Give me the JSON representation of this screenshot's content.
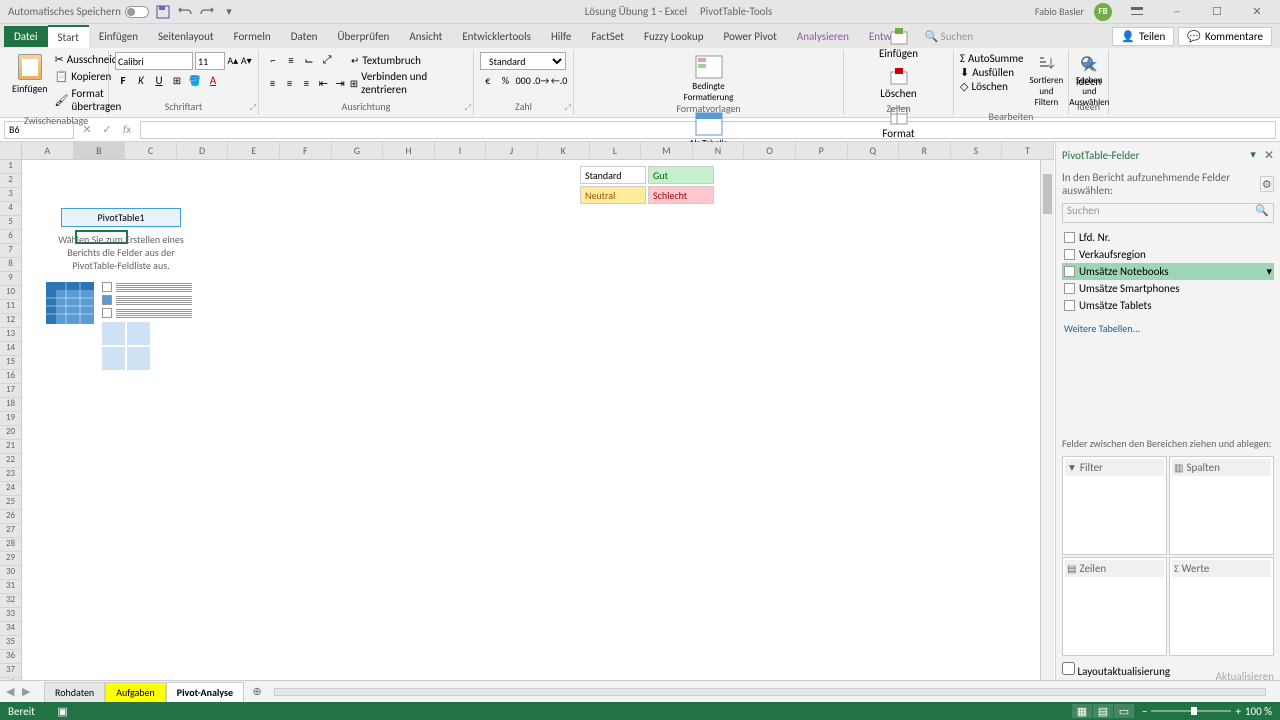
{
  "titlebar": {
    "autosave": "Automatisches Speichern",
    "doc_title": "Lösung Übung 1 - Excel",
    "context_tool": "PivotTable-Tools",
    "user_name": "Fabio Basler",
    "user_initials": "FB"
  },
  "tabs": {
    "file": "Datei",
    "items": [
      "Start",
      "Einfügen",
      "Seitenlayout",
      "Formeln",
      "Daten",
      "Überprüfen",
      "Ansicht",
      "Entwicklertools",
      "Hilfe",
      "FactSet",
      "Fuzzy Lookup",
      "Power Pivot",
      "Analysieren",
      "Entwurf"
    ],
    "search_hint": "Suchen",
    "share": "Teilen",
    "comments": "Kommentare"
  },
  "ribbon": {
    "clipboard": {
      "paste": "Einfügen",
      "cut": "Ausschneiden",
      "copy": "Kopieren",
      "format": "Format übertragen",
      "label": "Zwischenablage"
    },
    "font": {
      "name": "Calibri",
      "size": "11",
      "label": "Schriftart"
    },
    "align": {
      "wrap": "Textumbruch",
      "merge": "Verbinden und zentrieren",
      "label": "Ausrichtung"
    },
    "number": {
      "format": "Standard",
      "label": "Zahl"
    },
    "styles": {
      "cond": "Bedingte Formatierung",
      "table": "Als Tabelle formatieren",
      "standard": "Standard",
      "gut": "Gut",
      "neutral": "Neutral",
      "schlecht": "Schlecht",
      "label": "Formatvorlagen"
    },
    "cells": {
      "insert": "Einfügen",
      "delete": "Löschen",
      "format": "Format",
      "label": "Zellen"
    },
    "edit": {
      "sum": "AutoSumme",
      "fill": "Ausfüllen",
      "clear": "Löschen",
      "sort": "Sortieren und Filtern",
      "find": "Suchen und Auswählen",
      "label": "Bearbeiten"
    },
    "ideas": {
      "label": "Ideen",
      "btn": "Ideen"
    }
  },
  "namebox": {
    "cell": "B6"
  },
  "columns": [
    "A",
    "B",
    "C",
    "D",
    "E",
    "F",
    "G",
    "H",
    "I",
    "J",
    "K",
    "L",
    "M",
    "N",
    "O",
    "P",
    "Q",
    "R",
    "S",
    "T"
  ],
  "pivot_placeholder": {
    "title": "PivotTable1",
    "text": "Wählen Sie zum Erstellen eines Berichts die Felder aus der PivotTable-Feldliste aus."
  },
  "pivot_pane": {
    "title": "PivotTable-Felder",
    "subtitle": "In den Bericht aufzunehmende Felder auswählen:",
    "search": "Suchen",
    "fields": [
      "Lfd. Nr.",
      "Verkaufsregion",
      "Umsätze Notebooks",
      "Umsätze Smartphones",
      "Umsätze Tablets"
    ],
    "more": "Weitere Tabellen...",
    "drag_label": "Felder zwischen den Bereichen ziehen und ablegen:",
    "areas": {
      "filter": "Filter",
      "columns": "Spalten",
      "rows": "Zeilen",
      "values": "Werte"
    },
    "defer": "Layoutaktualisierung zurückstellen",
    "update": "Aktualisieren"
  },
  "sheets": {
    "tabs": [
      "Rohdaten",
      "Aufgaben",
      "Pivot-Analyse"
    ]
  },
  "statusbar": {
    "ready": "Bereit",
    "zoom": "100 %"
  }
}
